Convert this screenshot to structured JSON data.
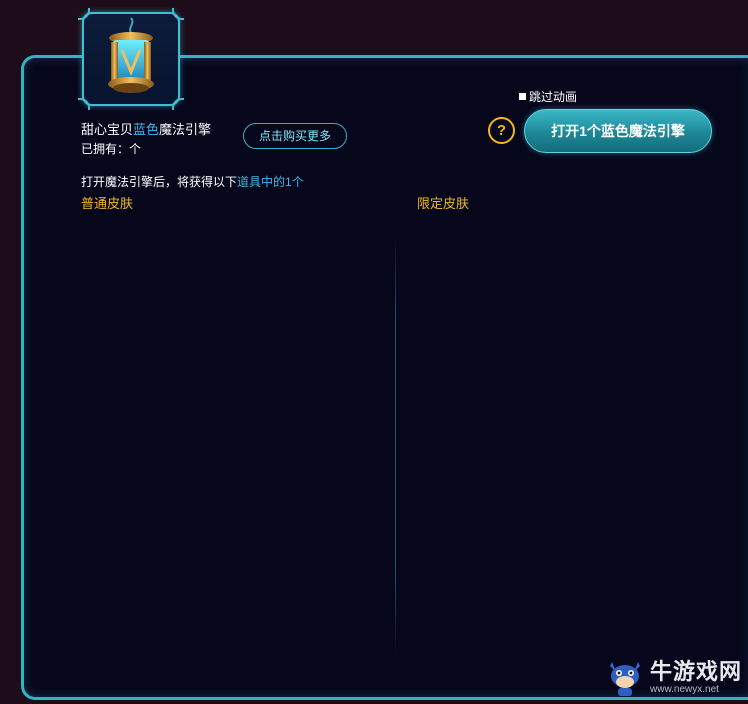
{
  "item": {
    "icon": "magic-engine-icon",
    "name_prefix": "甜心宝贝",
    "name_color_word": "蓝色",
    "name_suffix": "魔法引擎",
    "owned_label": "已拥有：个"
  },
  "buttons": {
    "buy_more": "点击购买更多",
    "help": "?",
    "open": "打开1个蓝色魔法引擎"
  },
  "skip_animation": "跳过动画",
  "description": {
    "prefix": "打开魔法引擎后，将获得以下",
    "highlight": "道具中的1个"
  },
  "columns": {
    "normal": "普通皮肤",
    "limited": "限定皮肤"
  },
  "watermark": {
    "name": "牛游戏网",
    "url": "www.newyx.net"
  },
  "colors": {
    "accent_cyan": "#2fb3c8",
    "highlight_blue": "#3fb6e6",
    "gold": "#f2b623",
    "panel_bg": "#07071c",
    "page_bg": "#1d0d1a"
  }
}
